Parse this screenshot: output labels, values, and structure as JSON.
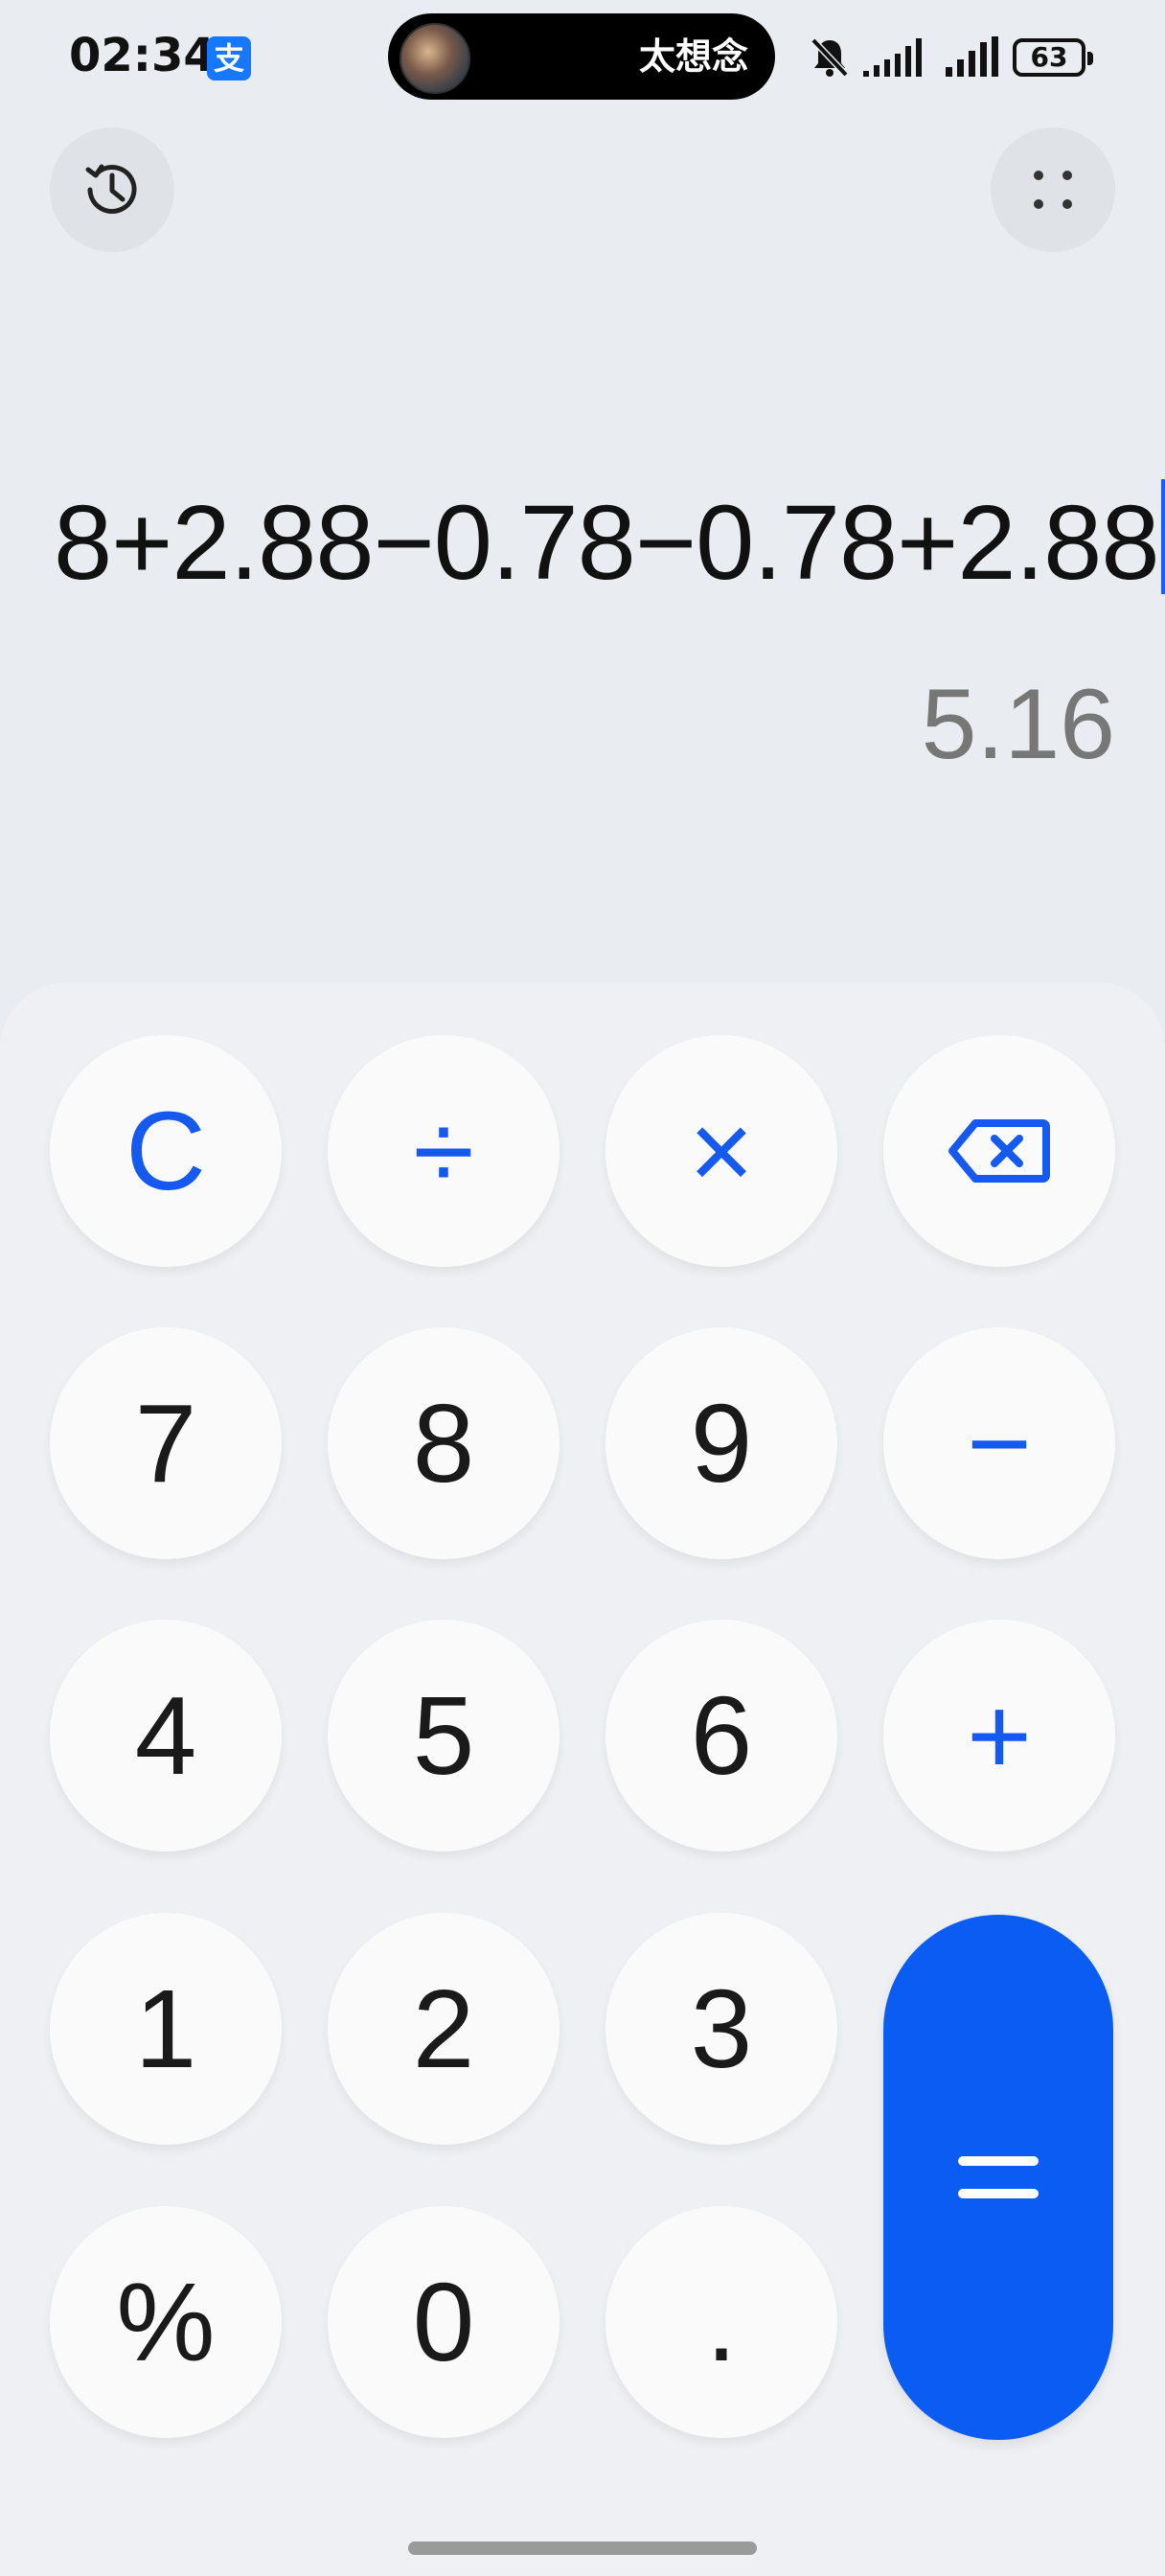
{
  "status_bar": {
    "time": "02:34",
    "alipay_icon": "支",
    "media_title": "太想念",
    "battery": "63"
  },
  "display": {
    "expression": "8+2.88−0.78−0.78+2.88",
    "result": "5.16"
  },
  "keys": {
    "clear": "C",
    "divide": "÷",
    "multiply": "×",
    "seven": "7",
    "eight": "8",
    "nine": "9",
    "minus": "−",
    "four": "4",
    "five": "5",
    "six": "6",
    "plus": "+",
    "one": "1",
    "two": "2",
    "three": "3",
    "percent": "%",
    "zero": "0",
    "decimal": "."
  },
  "colors": {
    "accent": "#1559ee",
    "equals_bg": "#0b5cf2",
    "background": "#e9ecf1"
  }
}
